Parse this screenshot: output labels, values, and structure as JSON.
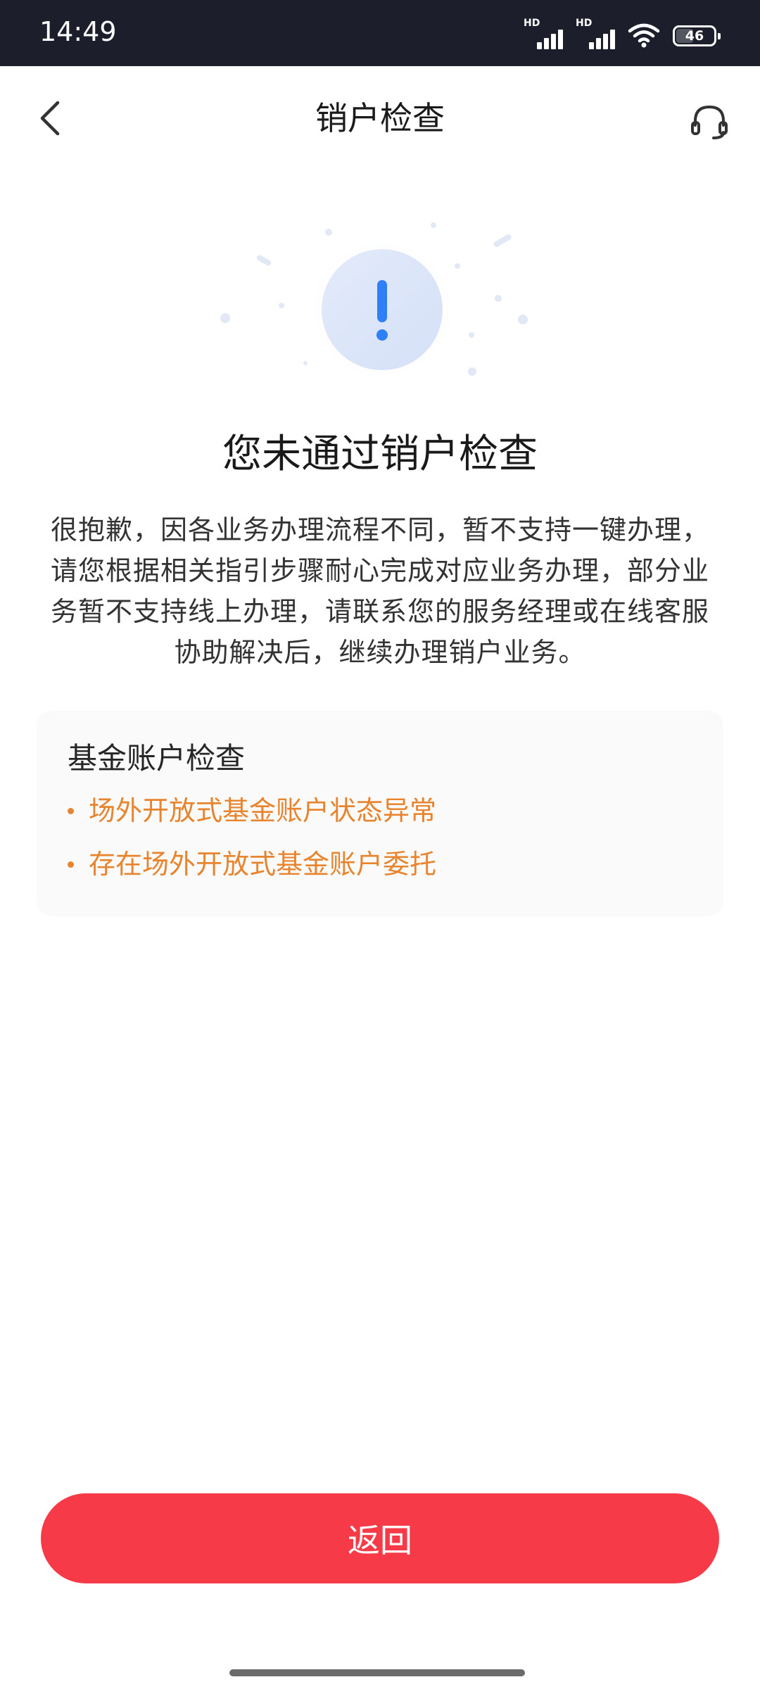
{
  "status_bar": {
    "time": "14:49",
    "sim1_label": "HD",
    "sim2_label": "HD",
    "battery_level": "46",
    "battery_fraction": 0.46
  },
  "nav": {
    "title": "销户检查",
    "back_icon": "chevron-left-icon",
    "support_icon": "headset-icon"
  },
  "result": {
    "icon": "exclamation-icon",
    "icon_color": "#2f7ff7",
    "title": "您未通过销户检查",
    "description": "很抱歉，因各业务办理流程不同，暂不支持一键办理，请您根据相关指引步骤耐心完成对应业务办理，部分业务暂不支持线上办理，请联系您的服务经理或在线客服协助解决后，继续办理销户业务。"
  },
  "check": {
    "title": "基金账户检查",
    "item_color": "#e8842e",
    "items": [
      "场外开放式基金账户状态异常",
      "存在场外开放式基金账户委托"
    ]
  },
  "actions": {
    "return_label": "返回",
    "return_color": "#f73a47"
  }
}
